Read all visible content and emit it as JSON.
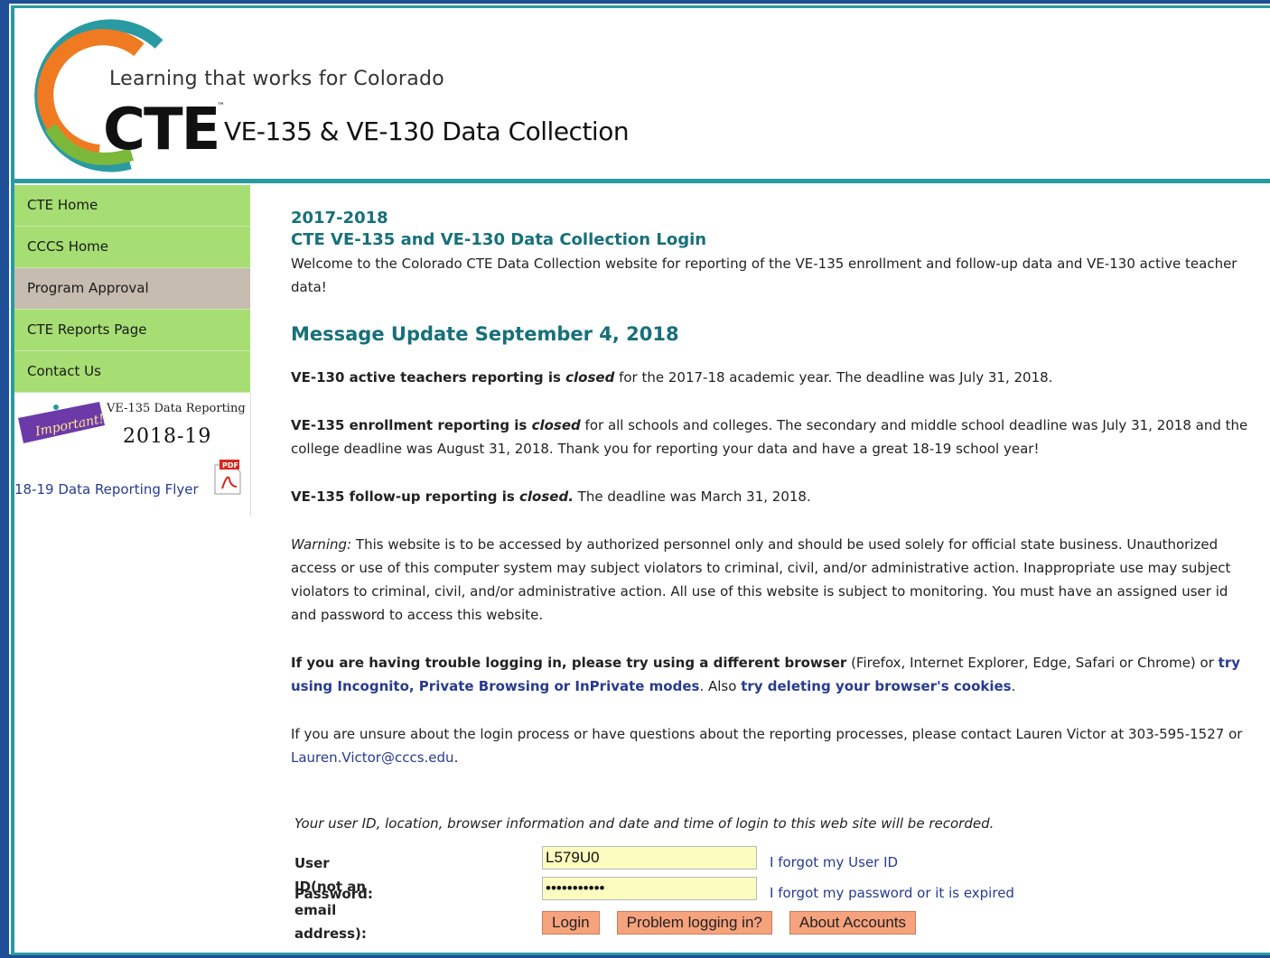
{
  "header": {
    "tagline": "Learning that works for Colorado",
    "brand": "CTE",
    "trademark": "™",
    "title": "VE-135 & VE-130 Data Collection"
  },
  "sidebar": {
    "items": [
      {
        "label": "CTE Home"
      },
      {
        "label": "CCCS Home"
      },
      {
        "label": "Program Approval"
      },
      {
        "label": "CTE Reports Page"
      },
      {
        "label": "Contact Us"
      }
    ],
    "promo": {
      "sticker_text": "Important!",
      "title": "VE-135 Data Reporting",
      "year": "2018-19",
      "flyer_link": "18-19 Data Reporting Flyer",
      "pdf_label": "PDF"
    }
  },
  "main": {
    "year": "2017-2018",
    "login_heading": "CTE VE-135 and VE-130 Data Collection Login",
    "welcome": "Welcome to the Colorado CTE Data Collection website for reporting of the VE-135 enrollment and follow-up data and VE-130 active teacher data!",
    "update_heading": "Message Update September 4, 2018",
    "ve130": {
      "lead": "VE-130 active teachers reporting is ",
      "status": "closed",
      "rest": " for the 2017-18 academic year. The deadline was July 31, 2018."
    },
    "ve135_enroll": {
      "lead": "VE-135 enrollment reporting is ",
      "status": "closed",
      "rest": " for all schools and colleges. The secondary and middle school deadline was July 31, 2018 and the college deadline was August 31, 2018. Thank you for reporting your data and have a great 18-19 school year!"
    },
    "ve135_follow": {
      "lead": "VE-135 follow-up reporting is ",
      "status": "closed.",
      "rest": " The deadline was March 31, 2018."
    },
    "warning": {
      "label": "Warning:",
      "text": " This website is to be accessed by authorized personnel only and should be used solely for official state business. Unauthorized access or use of this computer system may subject violators to criminal, civil, and/or administrative action. Inappropriate use may subject violators to criminal, civil, and/or administrative action. All use of this website is subject to monitoring. You must have an assigned user id and password to access this website."
    },
    "trouble": {
      "bold": "If you are having trouble logging in, please try using a different browser",
      "browsers": " (Firefox, Internet Explorer, Edge, Safari or Chrome) or ",
      "link1": "try using Incognito, Private Browsing or InPrivate modes",
      "mid": ". Also ",
      "link2": "try deleting your browser's cookies",
      "end": "."
    },
    "contact": {
      "text": "If you are unsure about the login process or have questions about the reporting processes, please contact Lauren Victor at 303-595-1527 or ",
      "email": "Lauren.Victor@cccs.edu",
      "end": "."
    }
  },
  "login": {
    "notice": "Your user ID, location, browser information and date and time of login to this web site will be recorded.",
    "userid_label": "User ID(not an email address):",
    "userid_value": "L579U0",
    "forgot_userid": "I forgot my User ID",
    "password_label": "Password:",
    "password_value": "•••••••••••",
    "forgot_password": "I forgot my password or it is expired",
    "buttons": {
      "login": "Login",
      "problem": "Problem logging in?",
      "about": "About Accounts"
    }
  },
  "colors": {
    "frame": "#1d4e96",
    "accent_teal": "#2a9aa2",
    "nav_green": "#a6de73",
    "nav_active": "#c6bcaf",
    "heading": "#17707a",
    "link": "#283b8f",
    "input_bg": "#fbfcbf",
    "button_bg": "#f6a37d"
  },
  "icons": {
    "logo": "cte-swoosh-logo",
    "pdf": "pdf-file-icon"
  }
}
